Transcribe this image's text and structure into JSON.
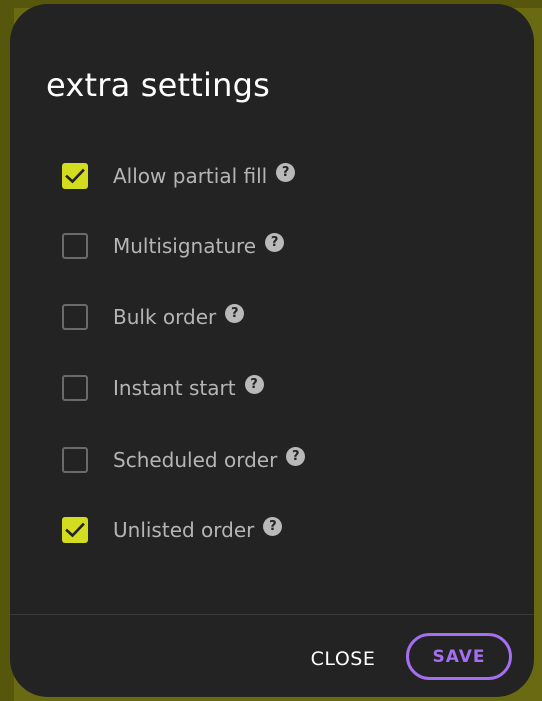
{
  "dialog": {
    "title": "extra settings",
    "help_icon_glyph": "?",
    "options": [
      {
        "label": "Allow partial fill",
        "checked": true
      },
      {
        "label": "Multisignature",
        "checked": false
      },
      {
        "label": "Bulk order",
        "checked": false
      },
      {
        "label": "Instant start",
        "checked": false
      },
      {
        "label": "Scheduled order",
        "checked": false
      },
      {
        "label": "Unlisted order",
        "checked": true
      }
    ],
    "footer": {
      "close_label": "CLOSE",
      "save_label": "SAVE"
    }
  },
  "colors": {
    "dialog_background": "#232323",
    "checkbox_checked": "#d4dc1f",
    "save_accent": "#a46ff0",
    "backdrop": "#5f6010"
  },
  "icons": {
    "checkmark": "checkmark-icon",
    "help": "question-circle-icon"
  }
}
